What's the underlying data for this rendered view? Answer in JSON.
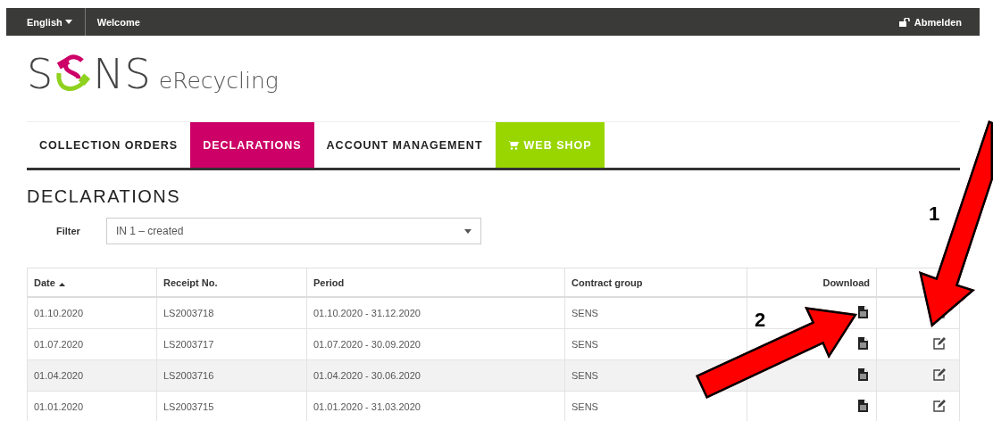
{
  "top_bar": {
    "language": "English",
    "welcome": "Welcome",
    "logout": "Abmelden"
  },
  "logo": {
    "lead": "S",
    "trail": "NS",
    "suffix": "eRecycling"
  },
  "tabs": [
    {
      "label": "COLLECTION ORDERS",
      "selected": false,
      "kind": "link"
    },
    {
      "label": "DECLARATIONS",
      "selected": true,
      "kind": "link"
    },
    {
      "label": "ACCOUNT MANAGEMENT",
      "selected": false,
      "kind": "link"
    },
    {
      "label": "WEB SHOP",
      "selected": false,
      "kind": "shop"
    }
  ],
  "heading": "DECLARATIONS",
  "filter": {
    "label": "Filter",
    "value": "IN 1 – created"
  },
  "table": {
    "columns": [
      {
        "label": "Date",
        "sorted": true
      },
      {
        "label": "Receipt No.",
        "sorted": false
      },
      {
        "label": "Period",
        "sorted": false
      },
      {
        "label": "Contract group",
        "sorted": false
      },
      {
        "label": "Download",
        "sorted": false
      }
    ],
    "rows": [
      {
        "date": "01.10.2020",
        "receipt": "LS2003718",
        "period": "01.10.2020 - 31.12.2020",
        "group": "SENS",
        "highlighted": false
      },
      {
        "date": "01.07.2020",
        "receipt": "LS2003717",
        "period": "01.07.2020 - 30.09.2020",
        "group": "SENS",
        "highlighted": false
      },
      {
        "date": "01.04.2020",
        "receipt": "LS2003716",
        "period": "01.04.2020 - 30.06.2020",
        "group": "SENS",
        "highlighted": true
      },
      {
        "date": "01.01.2020",
        "receipt": "LS2003715",
        "period": "01.01.2020 - 31.03.2020",
        "group": "SENS",
        "highlighted": false
      }
    ]
  },
  "annotations": [
    {
      "label": "1"
    },
    {
      "label": "2"
    }
  ]
}
